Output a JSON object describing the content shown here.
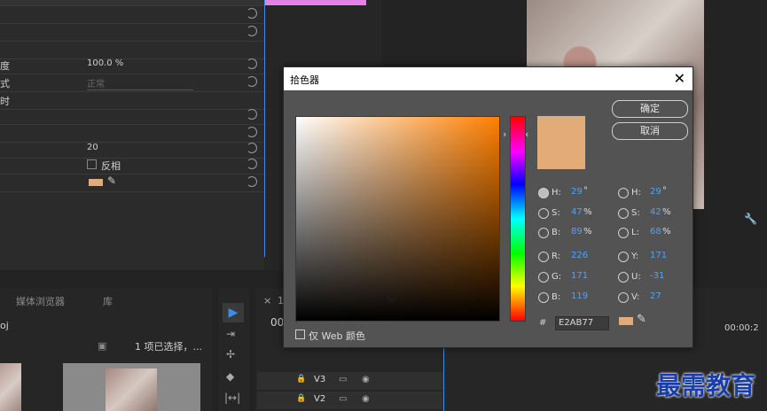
{
  "effects": {
    "rows": [
      {
        "label": "度",
        "value": "100.0 %"
      },
      {
        "label": "式",
        "value": "正常"
      },
      {
        "label": "时",
        "value": ""
      },
      {
        "label": "",
        "value": "20"
      },
      {
        "label": "",
        "value": "反相"
      }
    ]
  },
  "project_panel": {
    "tab_media_browser": "媒体浏览器",
    "tab_library": "库",
    "project_name": "oj",
    "selection_status": "1 项已选择，..."
  },
  "timeline": {
    "tab_close": "×",
    "tab_num": "1",
    "timecode": "00:00:2",
    "tracks": [
      "V3",
      "V2"
    ]
  },
  "dialog": {
    "title": "拾色器",
    "close_glyph": "✕",
    "ok_label": "确定",
    "cancel_label": "取消",
    "current_color": "#E2AB77",
    "hue_arrow_left": "›",
    "hue_arrow_right": "‹",
    "hsb": {
      "h_label": "H:",
      "h_value": "29",
      "h_unit": "°",
      "s_label": "S:",
      "s_value": "47",
      "s_unit": "%",
      "b_label": "B:",
      "b_value": "89",
      "b_unit": "%"
    },
    "rgb": {
      "r_label": "R:",
      "r_value": "226",
      "g_label": "G:",
      "g_value": "171",
      "b_label": "B:",
      "b_value": "119"
    },
    "hsl": {
      "h_label": "H:",
      "h_value": "29",
      "h_unit": "°",
      "s_label": "S:",
      "s_value": "42",
      "s_unit": "%",
      "l_label": "L:",
      "l_value": "68",
      "l_unit": "%"
    },
    "yuv": {
      "y_label": "Y:",
      "y_value": "171",
      "u_label": "U:",
      "u_value": "-31",
      "v_label": "V:",
      "v_value": "27"
    },
    "hex_hash": "#",
    "hex_value": "E2AB77",
    "web_only_label": "仅 Web 颜色",
    "selected_radio": "hsb-h"
  },
  "watermark": "最需教育"
}
